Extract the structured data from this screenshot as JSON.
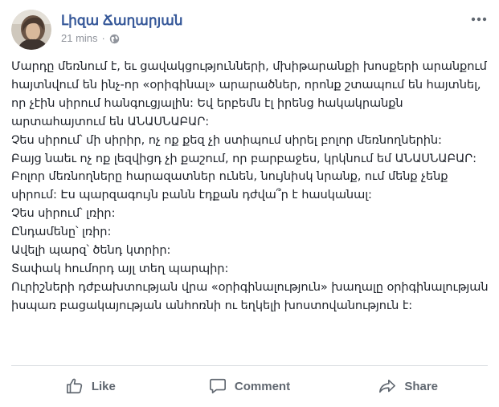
{
  "post": {
    "author": "Լիզա Ճաղարյան",
    "timestamp": "21 mins",
    "separator": "·",
    "privacy_icon": "globe-icon",
    "options_icon": "more-horizontal-icon",
    "paragraphs": [
      "Մարդը մեռնում է, եւ ցավակցությունների, մխիթարանքի խոսքերի արանքում հայտնվում են ինչ-որ «օրիգինալ» արարածներ, որոնք շտապում են հայտնել, որ չէին սիրում հանգուցյալին: Եվ երբեմն էլ իրենց հակակրանքն արտահայտում են ԱՆԱՍՆԱԲԱՐ:",
      "Չես սիրում՝ մի սիրիր, ոչ ոք քեզ չի ստիպում սիրել բոլոր մեռնողներին:",
      "Բայց նաեւ ոչ ոք լեզվիցդ չի քաշում, որ բարբաջես, կրկնում եմ ԱՆԱՍՆԱԲԱՐ: Բոլոր մեռնողները հարազատներ ունեն, նույնիսկ նրանք, ում մենք չենք սիրում: Էս պարզագույն բանն էդքան դժվա՞ր է հասկանալ:",
      "Չես սիրում՝ լռիր:",
      "Ընդամենը՝ լռիր:",
      "Ավելի պարզ՝ ծենդ կտրիր:",
      "Տափակ հումորդ այլ տեղ պարպիր:",
      "Ուրիշների դժբախտության վրա «օրիգինալություն» խաղալը օրիգինալության իսպառ բացակայության անհոռնի ու եղկելի խոստովանություն է:"
    ]
  },
  "actions": {
    "like": "Like",
    "comment": "Comment",
    "share": "Share"
  },
  "colors": {
    "author": "#365899",
    "meta": "#90949c",
    "text": "#1d2129",
    "action": "#606770",
    "divider": "#dadde1"
  }
}
